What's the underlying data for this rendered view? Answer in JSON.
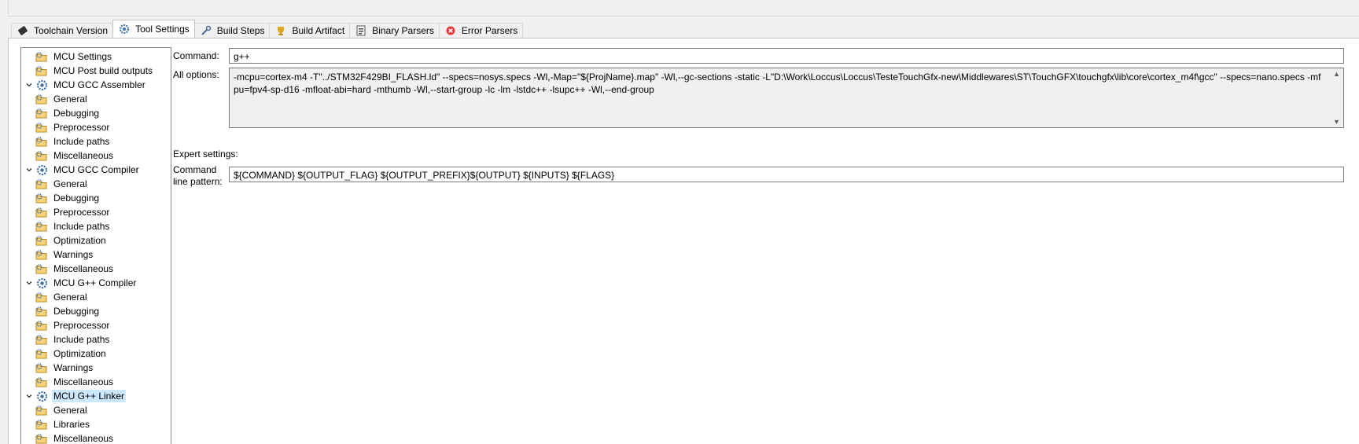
{
  "tabs": [
    {
      "label": "Toolchain  Version",
      "icon": "chip-icon"
    },
    {
      "label": "Tool Settings",
      "icon": "gear-icon"
    },
    {
      "label": "Build Steps",
      "icon": "wrench-icon"
    },
    {
      "label": "Build Artifact",
      "icon": "trophy-icon"
    },
    {
      "label": "Binary Parsers",
      "icon": "binary-file-icon"
    },
    {
      "label": "Error Parsers",
      "icon": "error-icon"
    }
  ],
  "tree": [
    {
      "label": "MCU Settings",
      "icon": "folder-gear-icon"
    },
    {
      "label": "MCU Post build outputs",
      "icon": "folder-gear-icon"
    },
    {
      "label": "MCU GCC Assembler",
      "icon": "gear-icon"
    },
    {
      "label": "General",
      "icon": "folder-gear-icon"
    },
    {
      "label": "Debugging",
      "icon": "folder-gear-icon"
    },
    {
      "label": "Preprocessor",
      "icon": "folder-gear-icon"
    },
    {
      "label": "Include paths",
      "icon": "folder-gear-icon"
    },
    {
      "label": "Miscellaneous",
      "icon": "folder-gear-icon"
    },
    {
      "label": "MCU GCC Compiler",
      "icon": "gear-icon"
    },
    {
      "label": "General",
      "icon": "folder-gear-icon"
    },
    {
      "label": "Debugging",
      "icon": "folder-gear-icon"
    },
    {
      "label": "Preprocessor",
      "icon": "folder-gear-icon"
    },
    {
      "label": "Include paths",
      "icon": "folder-gear-icon"
    },
    {
      "label": "Optimization",
      "icon": "folder-gear-icon"
    },
    {
      "label": "Warnings",
      "icon": "folder-gear-icon"
    },
    {
      "label": "Miscellaneous",
      "icon": "folder-gear-icon"
    },
    {
      "label": "MCU G++ Compiler",
      "icon": "gear-icon"
    },
    {
      "label": "General",
      "icon": "folder-gear-icon"
    },
    {
      "label": "Debugging",
      "icon": "folder-gear-icon"
    },
    {
      "label": "Preprocessor",
      "icon": "folder-gear-icon"
    },
    {
      "label": "Include paths",
      "icon": "folder-gear-icon"
    },
    {
      "label": "Optimization",
      "icon": "folder-gear-icon"
    },
    {
      "label": "Warnings",
      "icon": "folder-gear-icon"
    },
    {
      "label": "Miscellaneous",
      "icon": "folder-gear-icon"
    },
    {
      "label": "MCU G++ Linker",
      "icon": "gear-icon",
      "selected": true
    },
    {
      "label": "General",
      "icon": "folder-gear-icon"
    },
    {
      "label": "Libraries",
      "icon": "folder-gear-icon"
    },
    {
      "label": "Miscellaneous",
      "icon": "folder-gear-icon"
    }
  ],
  "settings": {
    "command_label": "Command:",
    "command_value": "g++",
    "all_options_label": "All options:",
    "all_options_value": "-mcpu=cortex-m4 -T\"../STM32F429BI_FLASH.ld\" --specs=nosys.specs -Wl,-Map=\"${ProjName}.map\" -Wl,--gc-sections -static -L\"D:\\Work\\Loccus\\Loccus\\TesteTouchGfx-new\\Middlewares\\ST\\TouchGFX\\touchgfx\\lib\\core\\cortex_m4f\\gcc\" --specs=nano.specs -mfpu=fpv4-sp-d16 -mfloat-abi=hard -mthumb -Wl,--start-group -lc -lm -lstdc++ -lsupc++ -Wl,--end-group",
    "expert_label": "Expert settings:",
    "pattern_label_1": "Command",
    "pattern_label_2": "line pattern:",
    "pattern_value": "${COMMAND} ${OUTPUT_FLAG} ${OUTPUT_PREFIX}${OUTPUT} ${INPUTS} ${FLAGS}"
  }
}
